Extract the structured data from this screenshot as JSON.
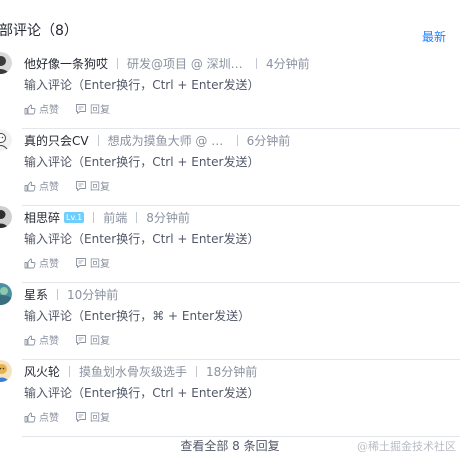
{
  "header": {
    "title": "部评论（8）",
    "sort_latest": "最新"
  },
  "comments": [
    {
      "username": "他好像一条狗哎",
      "job": "研发@项目 @ 深圳@...",
      "time": "4分钟前",
      "content": "输入评论（Enter换行，Ctrl + Enter发送）",
      "like_label": "点赞",
      "reply_label": "回复",
      "avatar_color": "#3b3b3b"
    },
    {
      "username": "真的只会CV",
      "job": "想成为摸鱼大师 @ 某...",
      "time": "6分钟前",
      "content": "输入评论（Enter换行，Ctrl + Enter发送）",
      "like_label": "点赞",
      "reply_label": "回复",
      "avatar_color": "#f2f2f2"
    },
    {
      "username": "相思碎",
      "level": "Lv.1",
      "job": "前端",
      "time": "8分钟前",
      "content": "输入评论（Enter换行，Ctrl + Enter发送）",
      "like_label": "点赞",
      "reply_label": "回复",
      "avatar_color": "#2e2e2e"
    },
    {
      "username": "星系",
      "time": "10分钟前",
      "content": "输入评论（Enter换行，⌘ + Enter发送）",
      "like_label": "点赞",
      "reply_label": "回复",
      "avatar_color": "#4a90a4"
    },
    {
      "username": "风火轮",
      "job": "摸鱼划水骨灰级选手",
      "time": "18分钟前",
      "content": "输入评论（Enter换行，Ctrl + Enter发送）",
      "like_label": "点赞",
      "reply_label": "回复",
      "avatar_color": "#e8b24a"
    }
  ],
  "footer": {
    "view_all": "查看全部 8 条回复"
  },
  "watermark": "@稀土掘金技术社区",
  "colors": {
    "accent": "#1e80ff",
    "secondary_text": "#8a919f",
    "divider": "#e4e6eb"
  }
}
